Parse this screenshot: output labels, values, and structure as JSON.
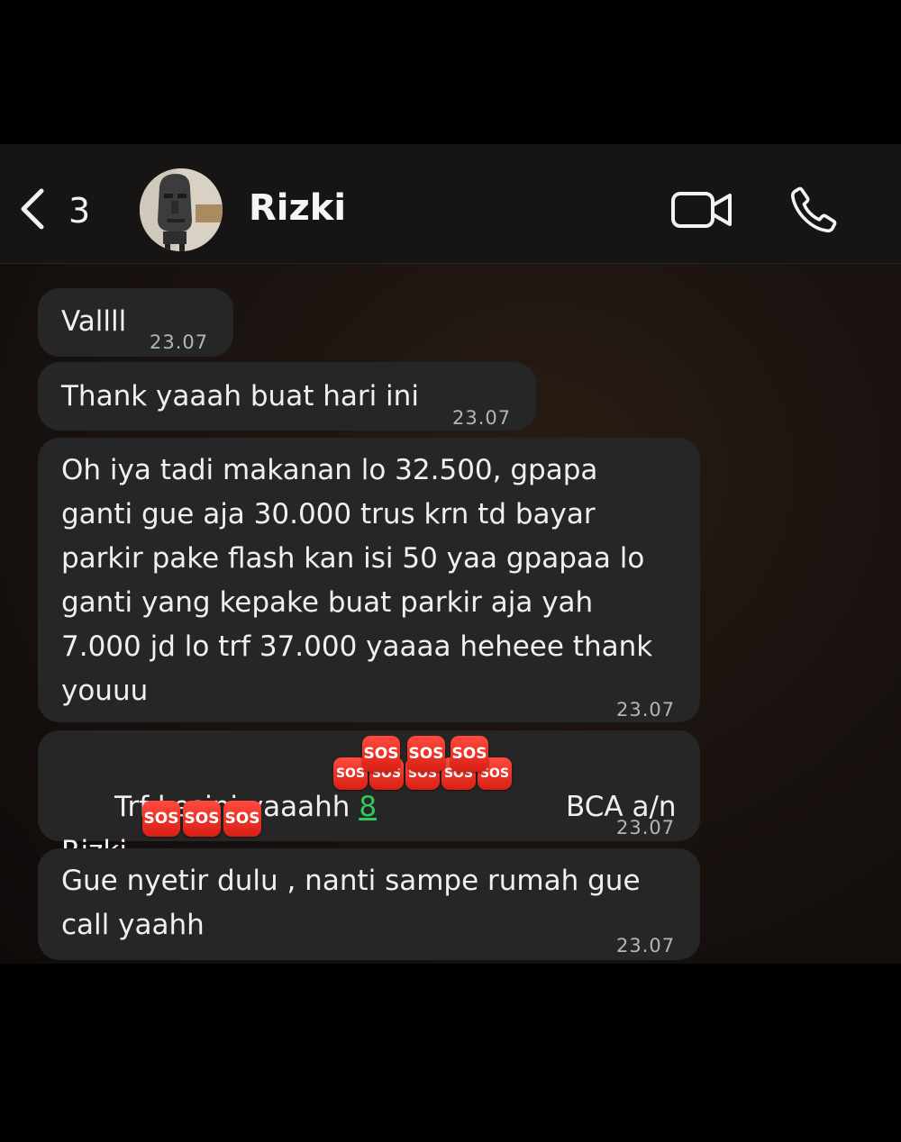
{
  "header": {
    "back_count": "3",
    "contact_name": "Rizki"
  },
  "messages": [
    {
      "text": "Vallll",
      "time": "23.07"
    },
    {
      "text": "Thank yaaah buat hari ini",
      "time": "23.07"
    },
    {
      "text": "Oh iya tadi makanan lo 32.500, gpapa\nganti gue aja 30.000 trus krn td bayar\nparkir pake flash kan isi 50 yaa gpapaa lo\nganti yang kepake buat parkir aja yah\n7.000 jd lo trf 37.000 yaaaa heheee thank\nyouuu",
      "time": "23.07"
    },
    {
      "text_prefix": "Trf kesini yaaahh ",
      "account_visible": "8",
      "text_suffix": "BCA a/n",
      "line2_prefix": "Rizki",
      "time": "23.07"
    },
    {
      "text": "Gue nyetir dulu , nanti sampe rumah gue\ncall yaahh",
      "time": "23.07"
    }
  ],
  "sticker_label": "SOS",
  "colors": {
    "bubble": "#262626",
    "header": "#171514",
    "link_green": "#34c759",
    "sos_red": "#e0281c"
  },
  "icons": [
    "chevron-left-icon",
    "video-camera-icon",
    "phone-icon",
    "sos-sticker-icon"
  ]
}
